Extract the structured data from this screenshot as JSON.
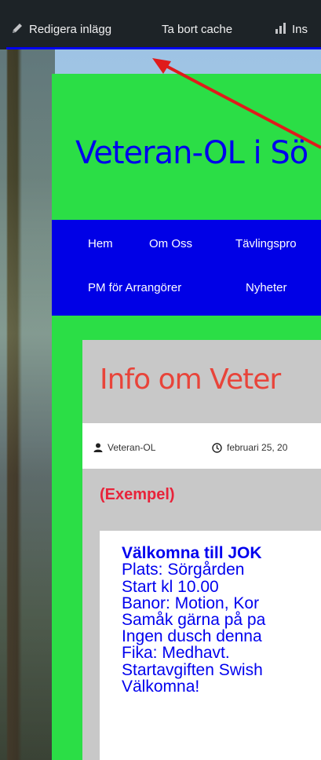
{
  "admin_bar": {
    "edit_label": "Redigera inlägg",
    "cache_label": "Ta bort cache",
    "insights_label": "Ins"
  },
  "site": {
    "title": "Veteran-OL i Sö",
    "nav_row1": [
      "Hem",
      "Om Oss",
      "Tävlingspro"
    ],
    "nav_row2": [
      "PM för Arrangörer",
      "Nyheter"
    ]
  },
  "post": {
    "title": "Info om Veter",
    "author": "Veteran-OL",
    "date": "februari 25, 20",
    "example_label": "(Exempel)",
    "lines": [
      "Välkomna till JOK",
      "Plats: Sörgården",
      "Start kl 10.00",
      "Banor: Motion, Kor",
      "Samåk gärna på pa",
      "Ingen dusch denna",
      "Fika: Medhavt.",
      "Startavgiften Swish",
      "Välkomna!"
    ]
  },
  "colors": {
    "admin_bar_bg": "#1d2327",
    "site_bg": "#2bde46",
    "nav_bg": "#0000e6",
    "title_blue": "#0000ee",
    "post_title_red": "#e8443a",
    "annotation_arrow": "#e01b1b"
  }
}
